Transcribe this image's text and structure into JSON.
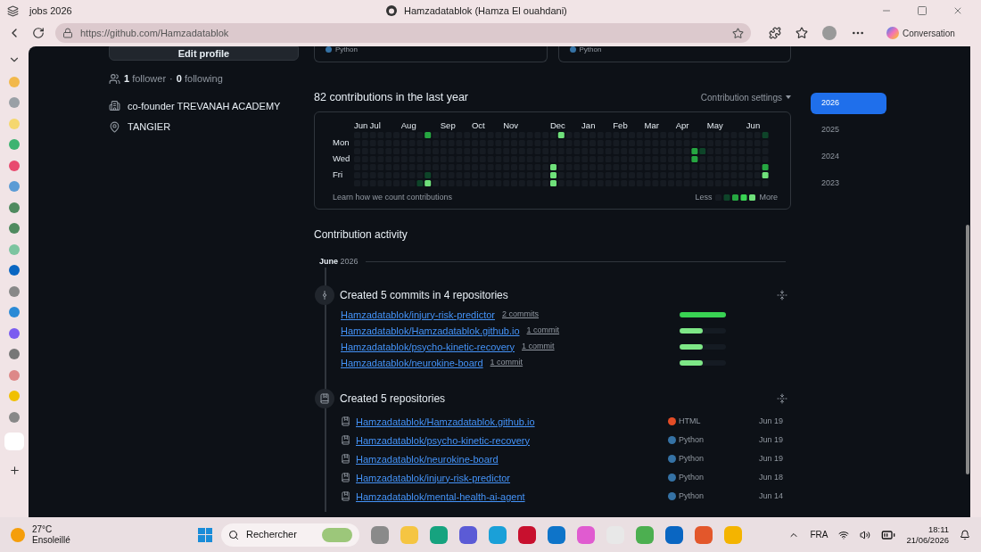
{
  "browser": {
    "tab_title": "jobs 2026",
    "window_title": "Hamzadatablok (Hamza El ouahdani)",
    "url": "https://github.com/Hamzadatablok",
    "copilot_button": "Conversation"
  },
  "profile": {
    "edit_button": "Edit profile",
    "followers_count": "1",
    "followers_label": "follower",
    "separator": "·",
    "following_count": "0",
    "following_label": "following",
    "details": [
      {
        "kind": "company",
        "text": "co-founder TREVANAH ACADEMY"
      },
      {
        "kind": "location",
        "text": "TANGIER"
      }
    ]
  },
  "pinned_languages": [
    "Python",
    "Python"
  ],
  "contributions": {
    "heading": "82 contributions in the last year",
    "settings": "Contribution settings",
    "months": [
      "Jun",
      "Jul",
      "Aug",
      "Sep",
      "Oct",
      "Nov",
      "Dec",
      "Jan",
      "Feb",
      "Mar",
      "Apr",
      "May",
      "Jun"
    ],
    "days": [
      "Mon",
      "Wed",
      "Fri"
    ],
    "footer_link": "Learn how we count contributions",
    "legend_less": "Less",
    "legend_more": "More"
  },
  "years": [
    {
      "label": "2026",
      "selected": true
    },
    {
      "label": "2025",
      "selected": false
    },
    {
      "label": "2024",
      "selected": false
    },
    {
      "label": "2023",
      "selected": false
    }
  ],
  "activity": {
    "heading": "Contribution activity",
    "month": "June",
    "year": "2026",
    "groups": [
      {
        "kind": "commits",
        "title": "Created 5 commits in 4 repositories",
        "items": [
          {
            "repo": "Hamzadatablok/injury-risk-predictor",
            "count": "2 commits",
            "level": 1
          },
          {
            "repo": "Hamzadatablok/Hamzadatablok.github.io",
            "count": "1 commit",
            "level": 0.5
          },
          {
            "repo": "Hamzadatablok/psycho-kinetic-recovery",
            "count": "1 commit",
            "level": 0.5
          },
          {
            "repo": "Hamzadatablok/neurokine-board",
            "count": "1 commit",
            "level": 0.5
          }
        ]
      },
      {
        "kind": "repos",
        "title": "Created 5 repositories",
        "items": [
          {
            "repo": "Hamzadatablok/Hamzadatablok.github.io",
            "language": "HTML",
            "color": "#e34c26",
            "date": "Jun 19"
          },
          {
            "repo": "Hamzadatablok/psycho-kinetic-recovery",
            "language": "Python",
            "color": "#3572a5",
            "date": "Jun 19"
          },
          {
            "repo": "Hamzadatablok/neurokine-board",
            "language": "Python",
            "color": "#3572a5",
            "date": "Jun 19"
          },
          {
            "repo": "Hamzadatablok/injury-risk-predictor",
            "language": "Python",
            "color": "#3572a5",
            "date": "Jun 18"
          },
          {
            "repo": "Hamzadatablok/mental-health-ai-agent",
            "language": "Python",
            "color": "#3572a5",
            "date": "Jun 14"
          }
        ]
      }
    ]
  },
  "taskbar": {
    "temperature": "27°C",
    "weather": "Ensoleillé",
    "search_placeholder": "Rechercher",
    "language": "FRA",
    "time": "18:11",
    "date": "21/06/2026"
  }
}
